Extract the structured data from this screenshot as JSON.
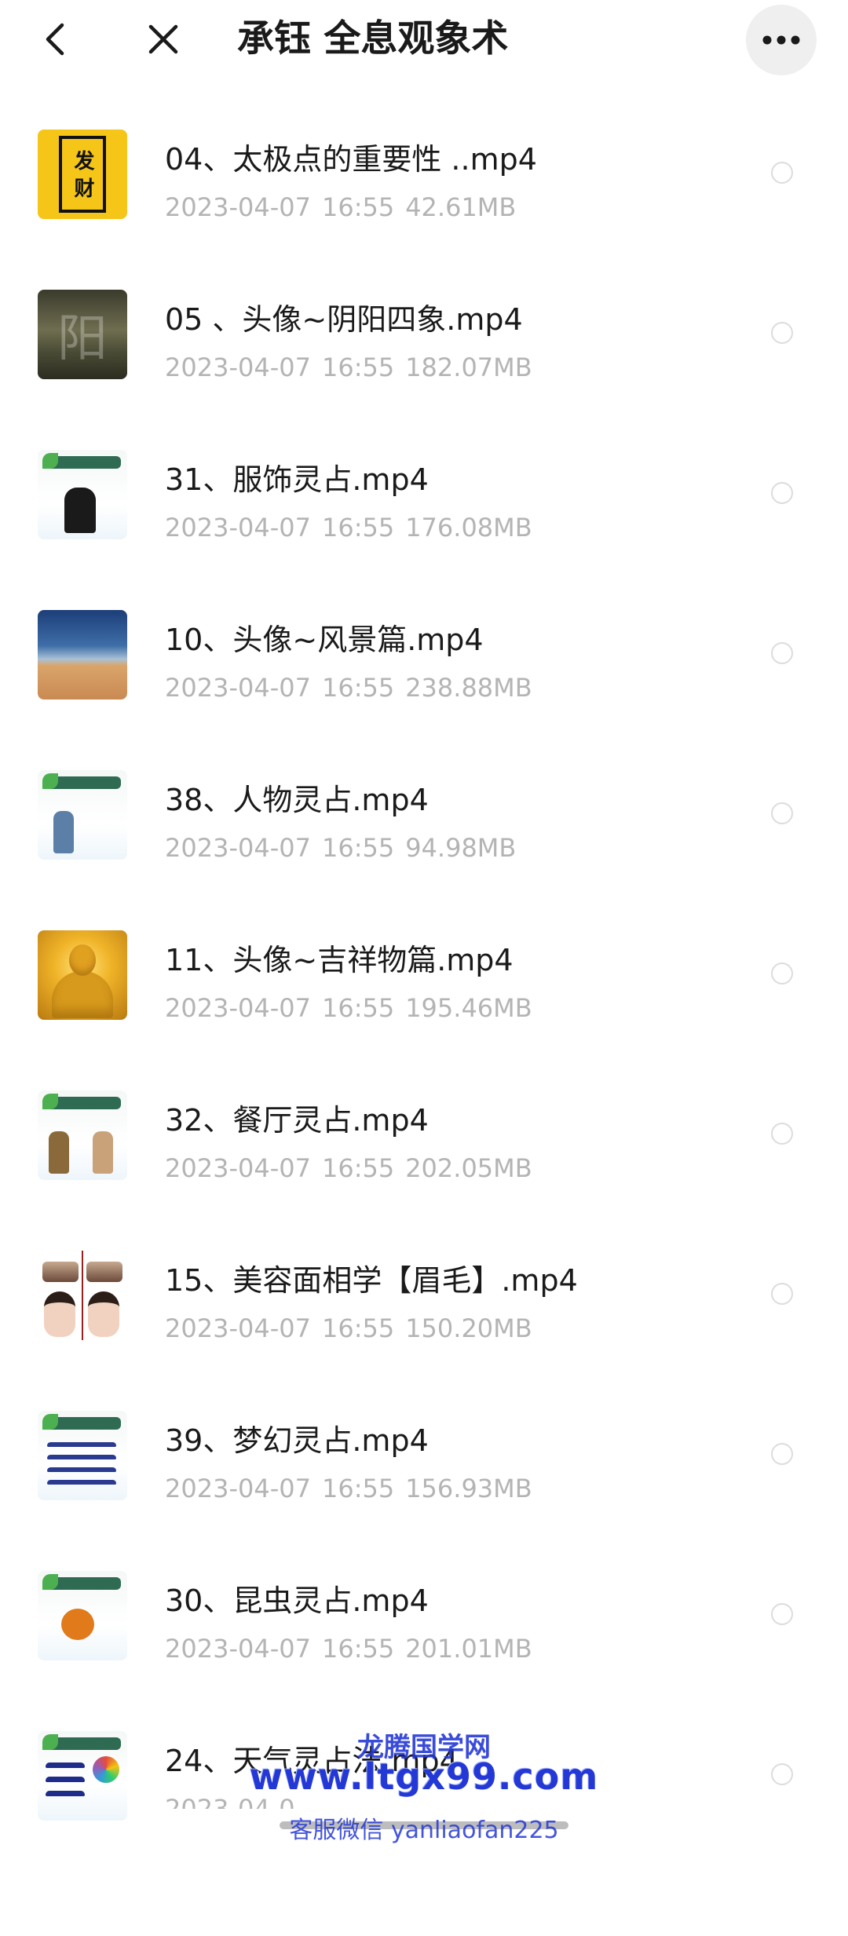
{
  "header": {
    "title": "承钰 全息观象术",
    "back_icon": "chevron-left-icon",
    "close_icon": "close-icon",
    "more_icon": "more-horizontal-icon"
  },
  "files": [
    {
      "name": "04、太极点的重要性 ..mp4",
      "date": "2023-04-07",
      "time": "16:55",
      "size": "42.61MB",
      "thumb": "fa-cai-poster",
      "thumb_text": "发 财"
    },
    {
      "name": "05 、头像~阴阳四象.mp4",
      "date": "2023-04-07",
      "time": "16:55",
      "size": "182.07MB",
      "thumb": "yin-yang-landscape",
      "thumb_text": "阳"
    },
    {
      "name": "31、服饰灵占.mp4",
      "date": "2023-04-07",
      "time": "16:55",
      "size": "176.08MB",
      "thumb": "clothing-card"
    },
    {
      "name": "10、头像~风景篇.mp4",
      "date": "2023-04-07",
      "time": "16:55",
      "size": "238.88MB",
      "thumb": "desert-landscape"
    },
    {
      "name": "38、人物灵占.mp4",
      "date": "2023-04-07",
      "time": "16:55",
      "size": "94.98MB",
      "thumb": "person-card"
    },
    {
      "name": "11、头像~吉祥物篇.mp4",
      "date": "2023-04-07",
      "time": "16:55",
      "size": "195.46MB",
      "thumb": "golden-buddha"
    },
    {
      "name": "32、餐厅灵占.mp4",
      "date": "2023-04-07",
      "time": "16:55",
      "size": "202.05MB",
      "thumb": "restaurant-card"
    },
    {
      "name": "15、美容面相学【眉毛】.mp4",
      "date": "2023-04-07",
      "time": "16:55",
      "size": "150.20MB",
      "thumb": "eyebrow-faces"
    },
    {
      "name": "39、梦幻灵占.mp4",
      "date": "2023-04-07",
      "time": "16:55",
      "size": "156.93MB",
      "thumb": "dream-card"
    },
    {
      "name": "30、昆虫灵占.mp4",
      "date": "2023-04-07",
      "time": "16:55",
      "size": "201.01MB",
      "thumb": "insect-card"
    },
    {
      "name": "24、天气灵占法.mp4",
      "date": "2023-04-0",
      "time": "",
      "size": "",
      "thumb": "weather-card"
    }
  ],
  "watermark": {
    "line1": "龙腾国学网",
    "line2": "www.ltgx99.com",
    "line3": "客服微信 yanliaofan225"
  },
  "colors": {
    "primary_text": "#1a1a1a",
    "secondary_text": "#b4b4b4",
    "radio_border": "#dcdcdc",
    "watermark": "#2438d6",
    "more_button_bg": "#efefef"
  }
}
